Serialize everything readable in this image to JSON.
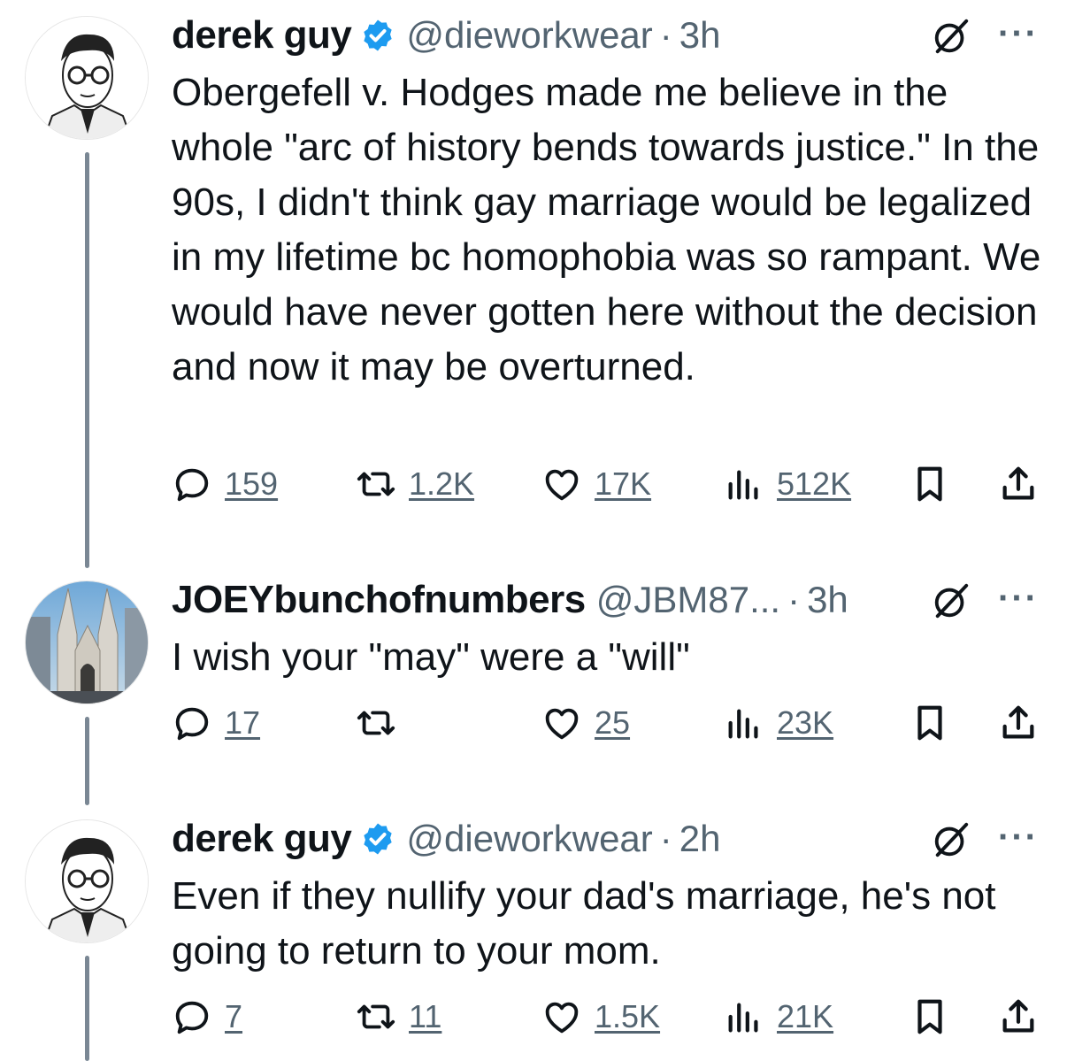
{
  "tweets": [
    {
      "name": "derek guy",
      "handle": "@dieworkwear",
      "time": "3h",
      "text": "Obergefell v. Hodges made me believe in the whole \"arc of history bends towards justice.\" In the 90s, I didn't think gay marriage would be legalized in my lifetime bc homophobia was so rampant. We would have never gotten here without the decision and now it may be overturned.",
      "replies": "159",
      "retweets": "1.2K",
      "likes": "17K",
      "views": "512K"
    },
    {
      "name": "JOEYbunchofnumbers",
      "handle": "@JBM87...",
      "time": "3h",
      "text": "I wish your \"may\" were a \"will\"",
      "replies": "17",
      "retweets": "",
      "likes": "25",
      "views": "23K"
    },
    {
      "name": "derek guy",
      "handle": "@dieworkwear",
      "time": "2h",
      "text": "Even if they nullify your dad's marriage, he's not going to return to your mom.",
      "replies": "7",
      "retweets": "11",
      "likes": "1.5K",
      "views": "21K"
    }
  ],
  "ui": {
    "separator": "·",
    "more": "···",
    "icons": [
      "verified-badge-icon",
      "grok-icon",
      "reply-icon",
      "retweet-icon",
      "like-icon",
      "views-icon",
      "bookmark-icon",
      "share-icon"
    ],
    "colors": {
      "text": "#0f1419",
      "secondary": "#536471",
      "verified": "#1d9bf0",
      "thread_line": "#7a8794"
    }
  }
}
